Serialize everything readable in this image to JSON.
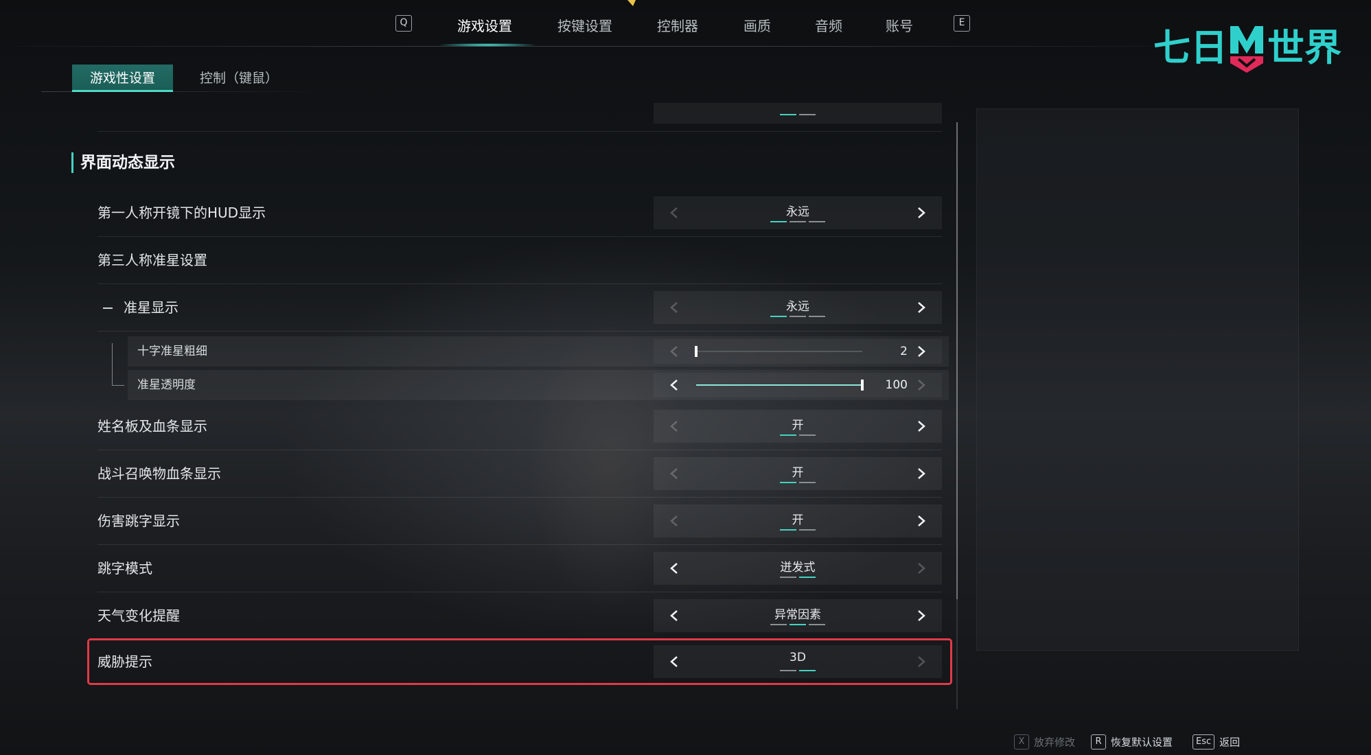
{
  "top_nav": {
    "left_key": "Q",
    "right_key": "E",
    "tabs": [
      "游戏设置",
      "按键设置",
      "控制器",
      "画质",
      "音频",
      "账号"
    ],
    "active_tab": "游戏设置"
  },
  "logo": {
    "text_left": "七日",
    "text_right": "世界"
  },
  "sub_tabs": {
    "active": "游戏性设置",
    "inactive": "控制（键鼠）"
  },
  "section": {
    "title": "界面动态显示"
  },
  "rows": [
    {
      "label": "第一人称开镜下的HUD显示",
      "value": "永远"
    },
    {
      "label": "第三人称准星设置"
    },
    {
      "label": "准星显示",
      "value": "永远"
    },
    {
      "label": "姓名板及血条显示",
      "value": "开"
    },
    {
      "label": "战斗召唤物血条显示",
      "value": "开"
    },
    {
      "label": "伤害跳字显示",
      "value": "开"
    },
    {
      "label": "跳字模式",
      "value": "迸发式"
    },
    {
      "label": "天气变化提醒",
      "value": "异常因素"
    },
    {
      "label": "威胁提示",
      "value": "3D"
    }
  ],
  "sliders": [
    {
      "label": "十字准星粗细",
      "value": "2",
      "fraction": 0.0
    },
    {
      "label": "准星透明度",
      "value": "100",
      "fraction": 1.0
    }
  ],
  "footer": {
    "discard": {
      "key": "X",
      "label": "放弃修改"
    },
    "reset": {
      "key": "R",
      "label": "恢复默认设置"
    },
    "back": {
      "key": "Esc",
      "label": "返回"
    }
  },
  "colors": {
    "accent": "#45d3c2",
    "highlight": "#e23a48"
  }
}
